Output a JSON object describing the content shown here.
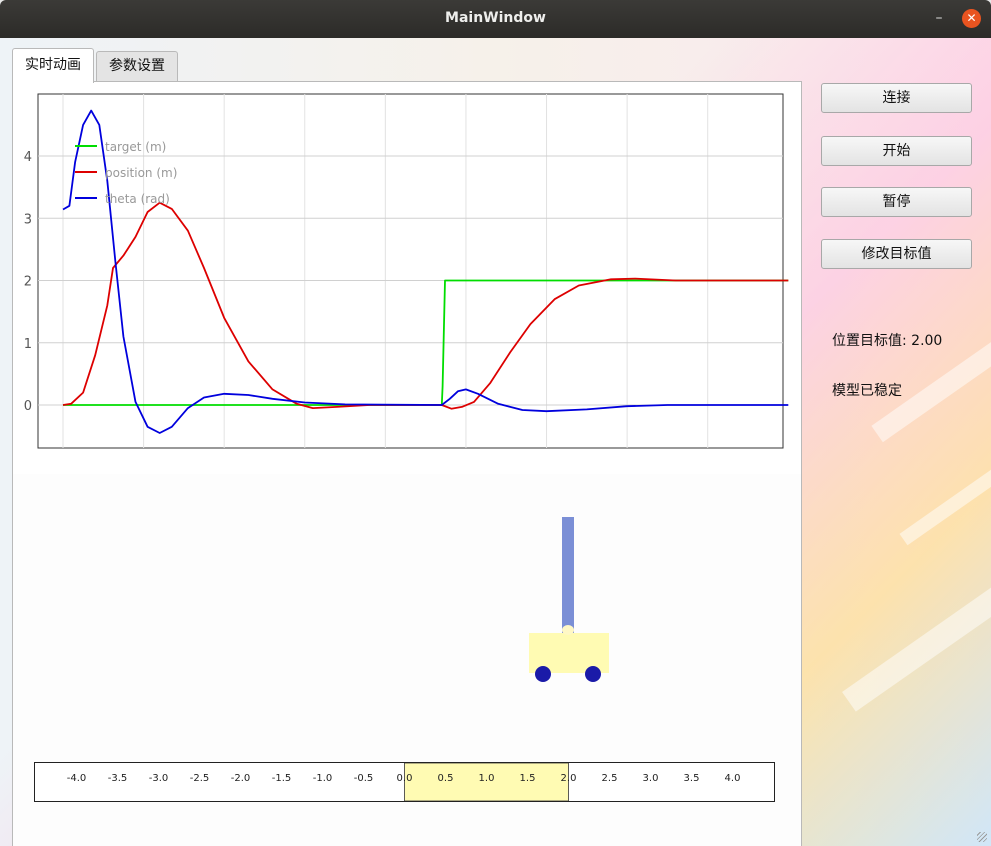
{
  "window": {
    "title": "MainWindow",
    "min_glyph": "–",
    "close_glyph": "✕"
  },
  "tabs": [
    {
      "label": "实时动画",
      "active": true
    },
    {
      "label": "参数设置",
      "active": false
    }
  ],
  "buttons": {
    "connect": "连接",
    "start": "开始",
    "pause": "暂停",
    "modify_target": "修改目标值"
  },
  "status": {
    "target_text": "位置目标值: 2.00",
    "model_text": "模型已稳定"
  },
  "chart_data": {
    "type": "line",
    "x_range": [
      0,
      9.0
    ],
    "ylim": [
      -0.75,
      5.0
    ],
    "yticks": [
      0,
      1,
      2,
      3,
      4
    ],
    "grid": true,
    "legend": "top-left",
    "series": [
      {
        "name": "target (m)",
        "color": "#00dd00",
        "points": [
          [
            0,
            0
          ],
          [
            4.7,
            0
          ],
          [
            4.71,
            0.3
          ],
          [
            4.74,
            2
          ],
          [
            9.0,
            2
          ]
        ]
      },
      {
        "name": "position (m)",
        "color": "#dd0000",
        "points": [
          [
            0,
            0
          ],
          [
            0.1,
            0.02
          ],
          [
            0.25,
            0.2
          ],
          [
            0.4,
            0.8
          ],
          [
            0.55,
            1.6
          ],
          [
            0.62,
            2.2
          ],
          [
            0.75,
            2.4
          ],
          [
            0.9,
            2.7
          ],
          [
            1.05,
            3.1
          ],
          [
            1.2,
            3.25
          ],
          [
            1.35,
            3.15
          ],
          [
            1.55,
            2.8
          ],
          [
            1.75,
            2.2
          ],
          [
            2.0,
            1.4
          ],
          [
            2.3,
            0.7
          ],
          [
            2.6,
            0.25
          ],
          [
            2.9,
            0.02
          ],
          [
            3.1,
            -0.05
          ],
          [
            3.4,
            -0.03
          ],
          [
            3.8,
            0.0
          ],
          [
            4.7,
            0.0
          ],
          [
            4.82,
            -0.06
          ],
          [
            4.95,
            -0.03
          ],
          [
            5.1,
            0.05
          ],
          [
            5.3,
            0.35
          ],
          [
            5.55,
            0.85
          ],
          [
            5.8,
            1.3
          ],
          [
            6.1,
            1.7
          ],
          [
            6.4,
            1.92
          ],
          [
            6.8,
            2.02
          ],
          [
            7.1,
            2.03
          ],
          [
            7.6,
            2.0
          ],
          [
            9.0,
            2.0
          ]
        ]
      },
      {
        "name": "theta (rad)",
        "color": "#0000dd",
        "points": [
          [
            0,
            3.14
          ],
          [
            0.08,
            3.2
          ],
          [
            0.15,
            3.9
          ],
          [
            0.25,
            4.5
          ],
          [
            0.35,
            4.73
          ],
          [
            0.45,
            4.5
          ],
          [
            0.55,
            3.6
          ],
          [
            0.65,
            2.3
          ],
          [
            0.75,
            1.1
          ],
          [
            0.9,
            0.05
          ],
          [
            1.05,
            -0.35
          ],
          [
            1.2,
            -0.45
          ],
          [
            1.35,
            -0.35
          ],
          [
            1.55,
            -0.05
          ],
          [
            1.75,
            0.12
          ],
          [
            2.0,
            0.18
          ],
          [
            2.3,
            0.16
          ],
          [
            2.6,
            0.1
          ],
          [
            3.0,
            0.04
          ],
          [
            3.5,
            0.01
          ],
          [
            4.7,
            0.0
          ],
          [
            4.8,
            0.1
          ],
          [
            4.9,
            0.22
          ],
          [
            5.0,
            0.25
          ],
          [
            5.15,
            0.18
          ],
          [
            5.4,
            0.02
          ],
          [
            5.7,
            -0.08
          ],
          [
            6.0,
            -0.1
          ],
          [
            6.5,
            -0.07
          ],
          [
            7.0,
            -0.02
          ],
          [
            7.5,
            0.0
          ],
          [
            9.0,
            0.0
          ]
        ]
      }
    ]
  },
  "animation": {
    "cart_position": 2.0,
    "pole_angle": 0.0,
    "highlight_range": [
      0.0,
      2.0
    ]
  },
  "ruler": {
    "range": [
      -4.5,
      4.5
    ],
    "tick_labels": [
      "-4.0",
      "-3.5",
      "-3.0",
      "-2.5",
      "-2.0",
      "-1.5",
      "-1.0",
      "-0.5",
      "0.0",
      "0.5",
      "1.0",
      "1.5",
      "2.0",
      "2.5",
      "3.0",
      "3.5",
      "4.0"
    ],
    "tick_values": [
      -4.0,
      -3.5,
      -3.0,
      -2.5,
      -2.0,
      -1.5,
      -1.0,
      -0.5,
      0.0,
      0.5,
      1.0,
      1.5,
      2.0,
      2.5,
      3.0,
      3.5,
      4.0
    ],
    "highlight_color": "#fffbb3"
  }
}
